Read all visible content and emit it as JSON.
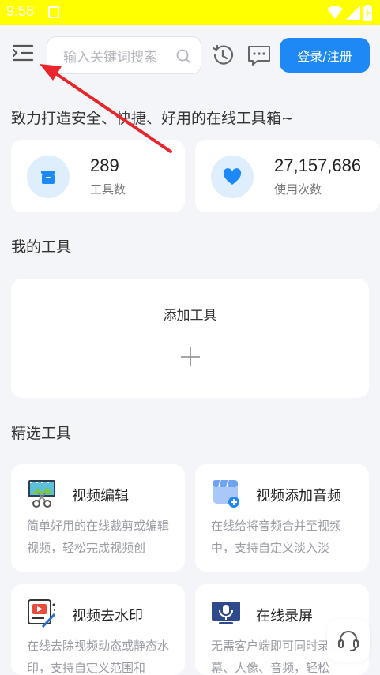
{
  "status_bar": {
    "time": "9:58"
  },
  "header": {
    "search_placeholder": "输入关键词搜索",
    "login_label": "登录/注册"
  },
  "slogan": "致力打造安全、快捷、好用的在线工具箱~",
  "stats": [
    {
      "value": "289",
      "label": "工具数",
      "icon": "box-icon"
    },
    {
      "value": "27,157,686",
      "label": "使用次数",
      "icon": "heart-icon"
    }
  ],
  "my_tools": {
    "title": "我的工具",
    "add_label": "添加工具"
  },
  "featured": {
    "title": "精选工具",
    "tools": [
      {
        "name": "视频编辑",
        "desc": "简单好用的在线裁剪或编辑视频，轻松完成视频创",
        "icon": "video-edit-icon"
      },
      {
        "name": "视频添加音频",
        "desc": "在线给将音频合并至视频中，支持自定义淡入淡",
        "icon": "video-add-audio-icon"
      },
      {
        "name": "视频去水印",
        "desc": "在线去除视频动态或静态水印，支持自定义范围和",
        "icon": "video-watermark-icon"
      },
      {
        "name": "在线录屏",
        "desc": "无需客户端即可同时录制屏幕、人像、音频，轻松",
        "icon": "screen-record-icon"
      }
    ]
  },
  "colors": {
    "status_bar": "#ffff00",
    "accent": "#1e88f5",
    "arrow": "#e8262b"
  }
}
